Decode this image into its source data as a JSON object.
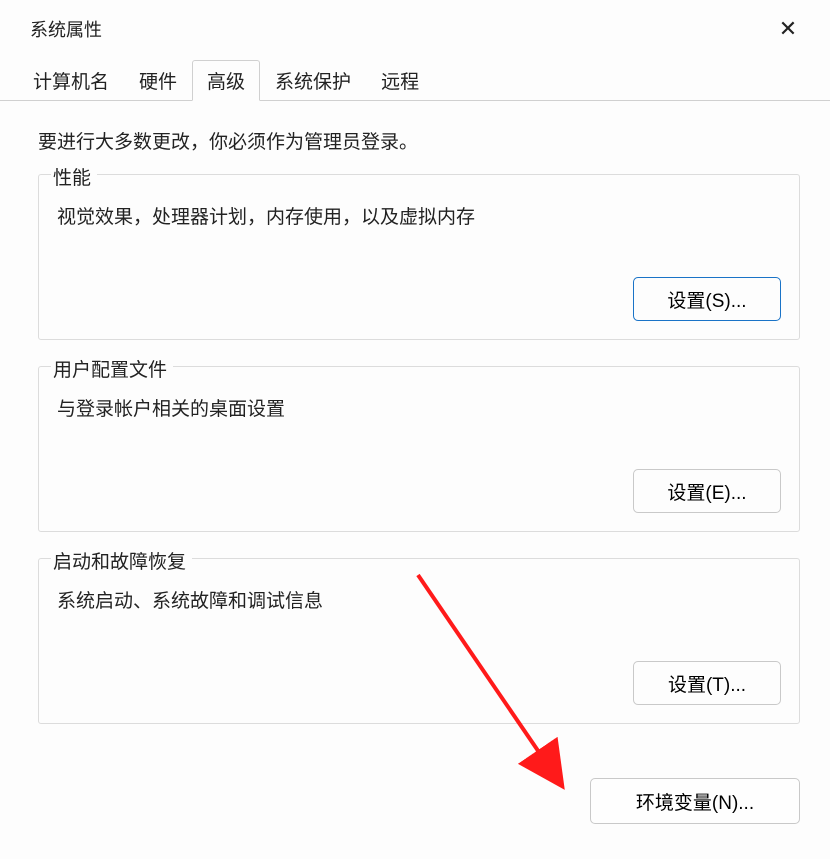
{
  "window": {
    "title": "系统属性",
    "close_glyph": "✕"
  },
  "tabs": {
    "computer_name": "计算机名",
    "hardware": "硬件",
    "advanced": "高级",
    "system_protection": "系统保护",
    "remote": "远程"
  },
  "intro": "要进行大多数更改，你必须作为管理员登录。",
  "groups": {
    "performance": {
      "legend": "性能",
      "desc": "视觉效果，处理器计划，内存使用，以及虚拟内存",
      "button": "设置(S)..."
    },
    "user_profiles": {
      "legend": "用户配置文件",
      "desc": "与登录帐户相关的桌面设置",
      "button": "设置(E)..."
    },
    "startup": {
      "legend": "启动和故障恢复",
      "desc": "系统启动、系统故障和调试信息",
      "button": "设置(T)..."
    }
  },
  "env_button": "环境变量(N)..."
}
